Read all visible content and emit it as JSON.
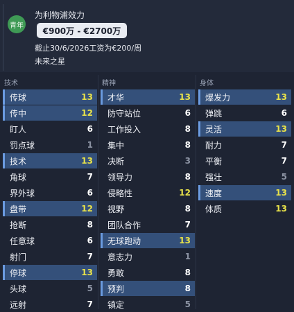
{
  "header": {
    "badge": "青年",
    "club": "为利物浦效力",
    "value": "€900万 - €2700万",
    "contract": "截止30/6/2026工资为€200/周",
    "tag": "未来之星"
  },
  "columns": [
    {
      "title": "技术",
      "rows": [
        {
          "label": "传球",
          "value": "13",
          "hl": true
        },
        {
          "label": "传中",
          "value": "12",
          "hl": true
        },
        {
          "label": "盯人",
          "value": "6"
        },
        {
          "label": "罚点球",
          "value": "1"
        },
        {
          "label": "技术",
          "value": "13",
          "hl": true
        },
        {
          "label": "角球",
          "value": "7"
        },
        {
          "label": "界外球",
          "value": "6"
        },
        {
          "label": "盘带",
          "value": "12",
          "hl": true
        },
        {
          "label": "抢断",
          "value": "8"
        },
        {
          "label": "任意球",
          "value": "6"
        },
        {
          "label": "射门",
          "value": "7"
        },
        {
          "label": "停球",
          "value": "13",
          "hl": true
        },
        {
          "label": "头球",
          "value": "5"
        },
        {
          "label": "远射",
          "value": "7"
        }
      ]
    },
    {
      "title": "精神",
      "rows": [
        {
          "label": "才华",
          "value": "13",
          "hl": true
        },
        {
          "label": "防守站位",
          "value": "6"
        },
        {
          "label": "工作投入",
          "value": "8"
        },
        {
          "label": "集中",
          "value": "8"
        },
        {
          "label": "决断",
          "value": "3"
        },
        {
          "label": "领导力",
          "value": "8"
        },
        {
          "label": "侵略性",
          "value": "12"
        },
        {
          "label": "视野",
          "value": "8"
        },
        {
          "label": "团队合作",
          "value": "7"
        },
        {
          "label": "无球跑动",
          "value": "13",
          "hl": true
        },
        {
          "label": "意志力",
          "value": "1"
        },
        {
          "label": "勇敢",
          "value": "8"
        },
        {
          "label": "预判",
          "value": "8",
          "hl": true
        },
        {
          "label": "镇定",
          "value": "5"
        }
      ]
    },
    {
      "title": "身体",
      "rows": [
        {
          "label": "爆发力",
          "value": "13",
          "hl": true
        },
        {
          "label": "弹跳",
          "value": "6"
        },
        {
          "label": "灵活",
          "value": "13",
          "hl": true
        },
        {
          "label": "耐力",
          "value": "7"
        },
        {
          "label": "平衡",
          "value": "7"
        },
        {
          "label": "强壮",
          "value": "5"
        },
        {
          "label": "速度",
          "value": "13",
          "hl": true
        },
        {
          "label": "体质",
          "value": "13"
        }
      ]
    }
  ],
  "colors": {
    "yellow": "#e8e24a",
    "dim": "#8c93a3",
    "highlight": "#34507a"
  }
}
